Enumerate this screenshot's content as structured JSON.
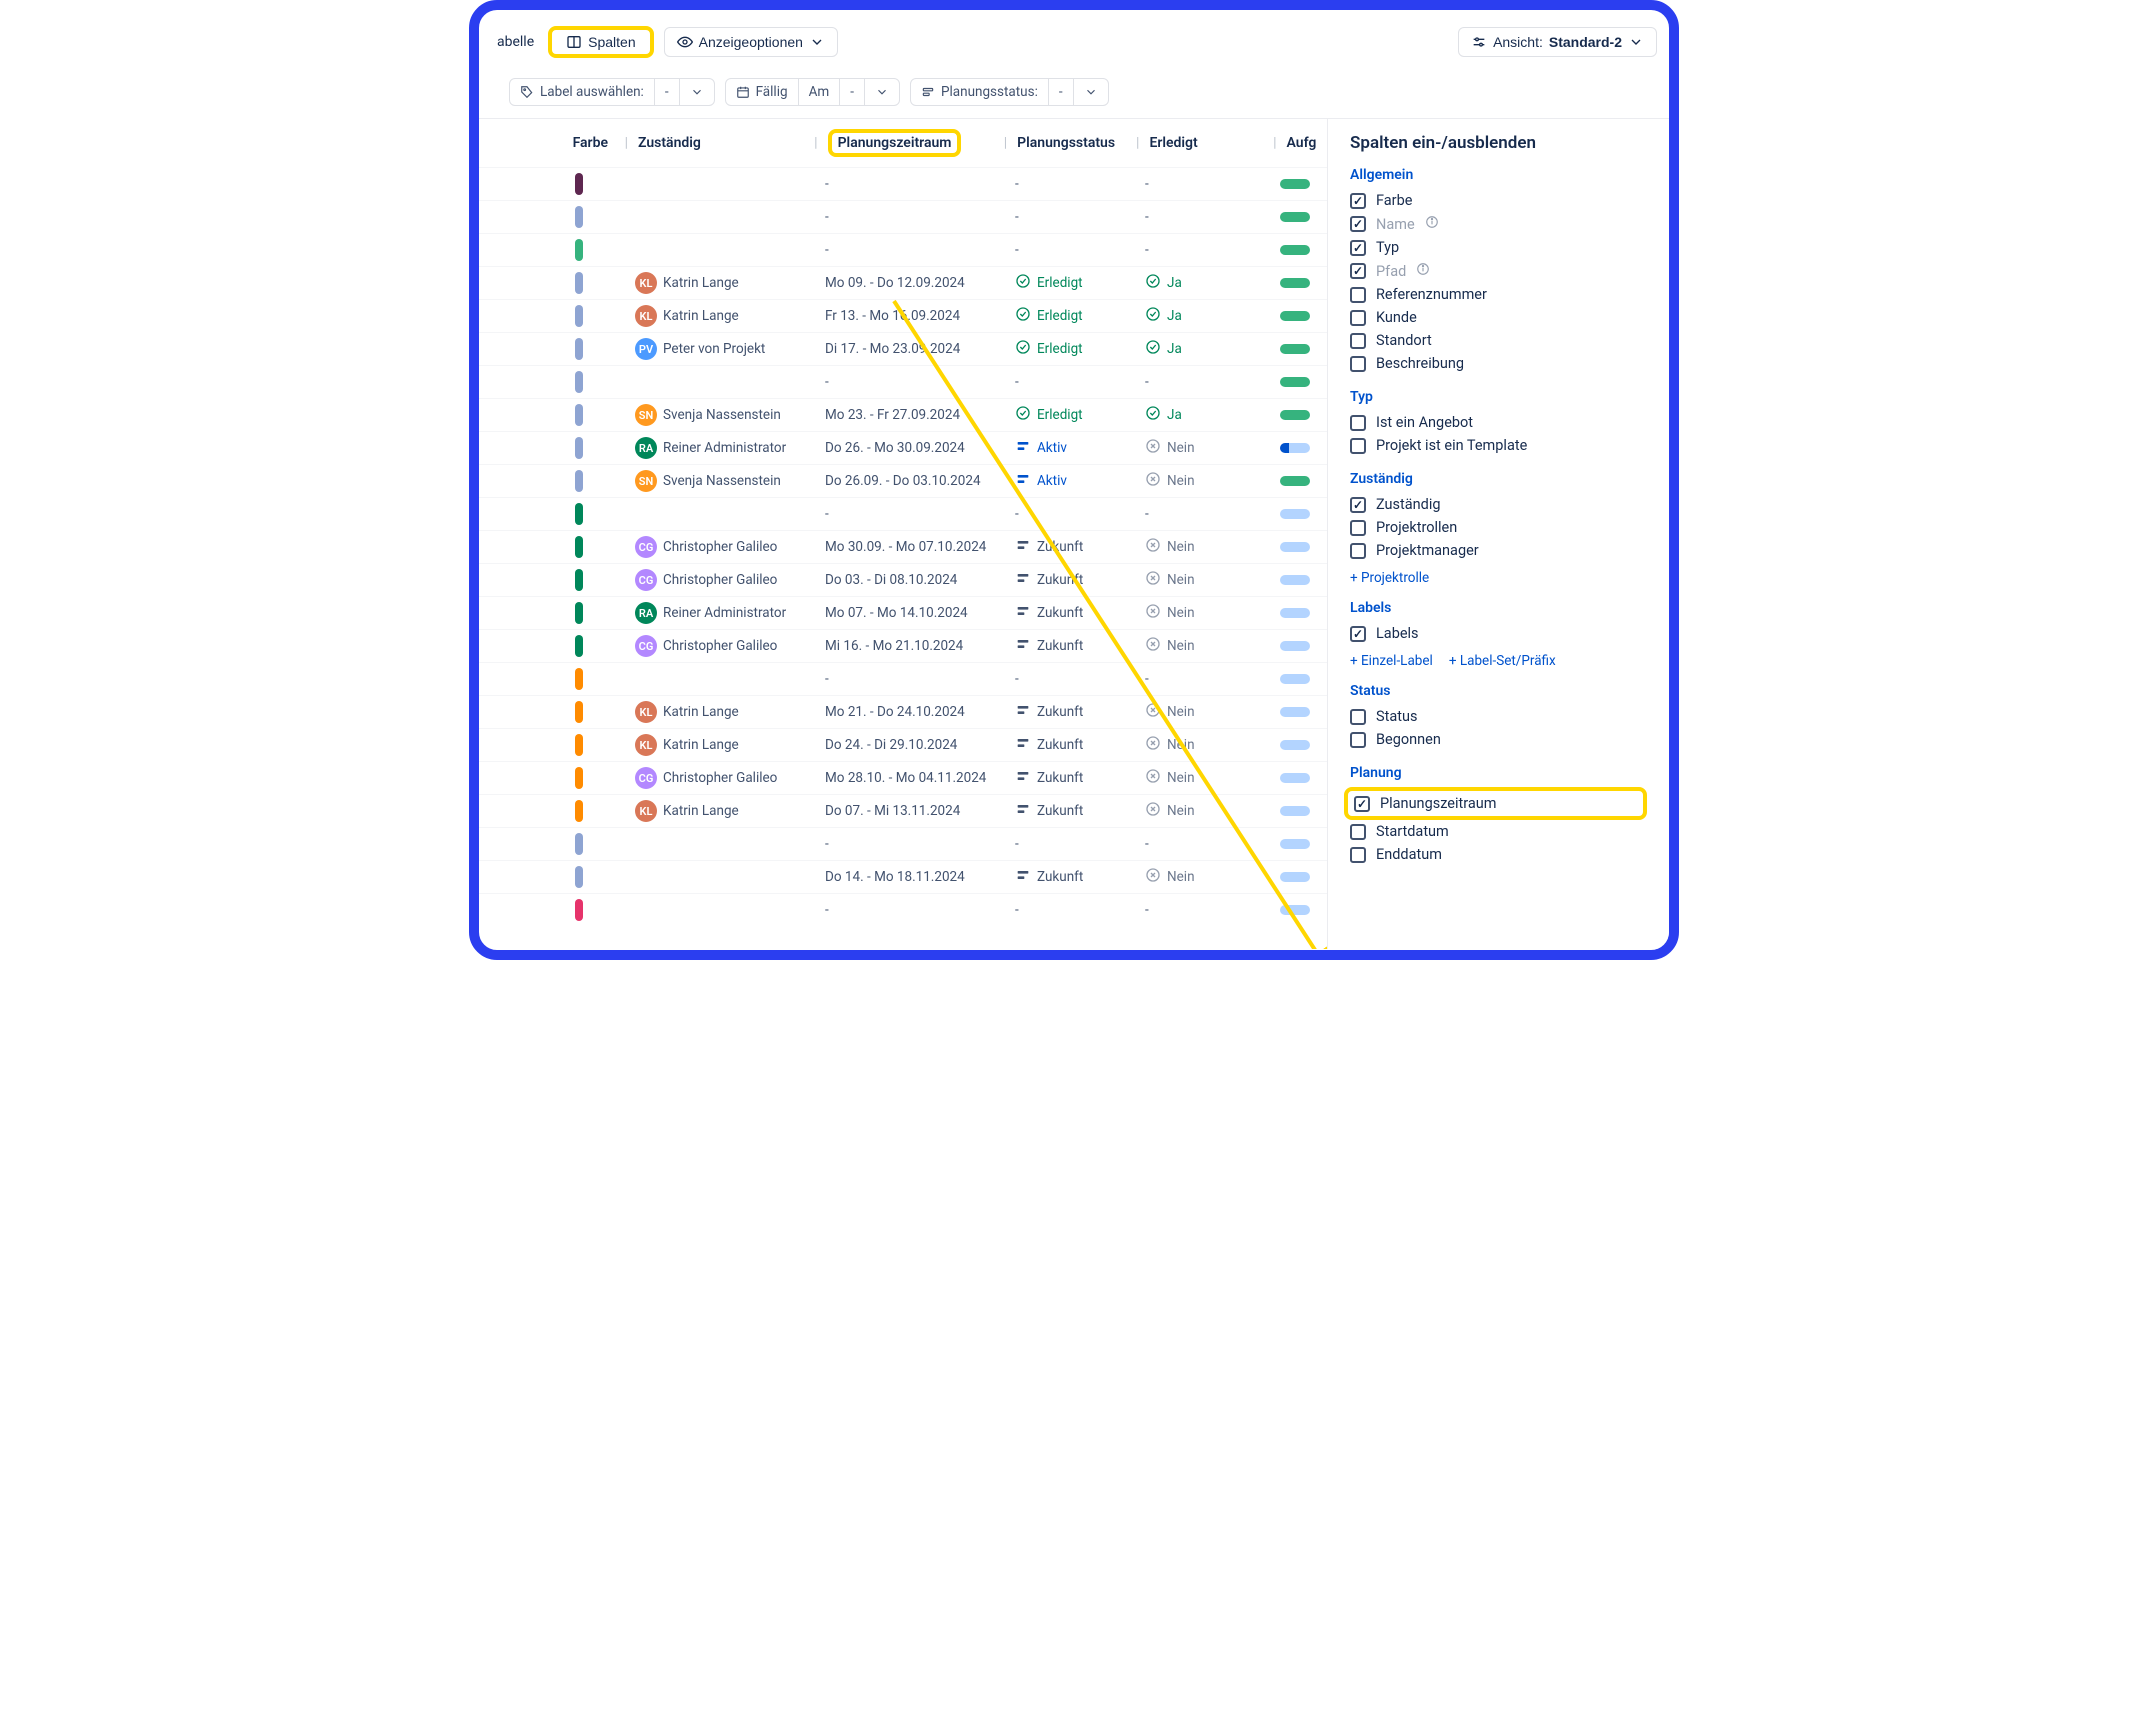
{
  "toolbar": {
    "tabelle_label": "abelle",
    "spalten_label": "Spalten",
    "anzeige_label": "Anzeigeoptionen",
    "ansicht_prefix": "Ansicht:",
    "ansicht_value": "Standard-2"
  },
  "filters": {
    "label_select": "Label auswählen:",
    "label_dash": "-",
    "faellig": "Fällig",
    "am": "Am",
    "am_dash": "-",
    "planungsstatus": "Planungsstatus:",
    "plan_dash": "-"
  },
  "columns": {
    "farbe": "Farbe",
    "zustaendig": "Zuständig",
    "planungszeitraum": "Planungszeitraum",
    "planungsstatus": "Planungsstatus",
    "erledigt": "Erledigt",
    "aufg": "Aufg"
  },
  "rows": [
    {
      "color": "#5e2750",
      "assignee": null,
      "range": "-",
      "status": "-",
      "done": "-",
      "bar": "green"
    },
    {
      "color": "#8ea4d2",
      "assignee": null,
      "range": "-",
      "status": "-",
      "done": "-",
      "bar": "green"
    },
    {
      "color": "#36b37e",
      "assignee": null,
      "range": "-",
      "status": "-",
      "done": "-",
      "bar": "green"
    },
    {
      "color": "#8ea4d2",
      "assignee": {
        "name": "Katrin Lange",
        "bg": "#d97757"
      },
      "range": "Mo 09. - Do 12.09.2024",
      "status": "Erledigt",
      "done": "Ja",
      "bar": "green"
    },
    {
      "color": "#8ea4d2",
      "assignee": {
        "name": "Katrin Lange",
        "bg": "#d97757"
      },
      "range": "Fr 13. - Mo 16.09.2024",
      "status": "Erledigt",
      "done": "Ja",
      "bar": "green"
    },
    {
      "color": "#8ea4d2",
      "assignee": {
        "name": "Peter von Projekt",
        "bg": "#4c9aff"
      },
      "range": "Di 17. - Mo 23.09.2024",
      "status": "Erledigt",
      "done": "Ja",
      "bar": "green"
    },
    {
      "color": "#8ea4d2",
      "assignee": null,
      "range": "-",
      "status": "-",
      "done": "-",
      "bar": "green"
    },
    {
      "color": "#8ea4d2",
      "assignee": {
        "name": "Svenja Nassenstein",
        "bg": "#ff991f"
      },
      "range": "Mo 23. - Fr 27.09.2024",
      "status": "Erledigt",
      "done": "Ja",
      "bar": "green"
    },
    {
      "color": "#8ea4d2",
      "assignee": {
        "name": "Reiner Administrator",
        "bg": "#00875a"
      },
      "range": "Do 26. - Mo 30.09.2024",
      "status": "Aktiv",
      "done": "Nein",
      "bar": "halfblue"
    },
    {
      "color": "#8ea4d2",
      "assignee": {
        "name": "Svenja Nassenstein",
        "bg": "#ff991f"
      },
      "range": "Do 26.09. - Do 03.10.2024",
      "status": "Aktiv",
      "done": "Nein",
      "bar": "green"
    },
    {
      "color": "#00875a",
      "assignee": null,
      "range": "-",
      "status": "-",
      "done": "-",
      "bar": "grayblue"
    },
    {
      "color": "#00875a",
      "assignee": {
        "name": "Christopher Galileo",
        "bg": "#b388ff"
      },
      "range": "Mo 30.09. - Mo 07.10.2024",
      "status": "Zukunft",
      "done": "Nein",
      "bar": "grayblue"
    },
    {
      "color": "#00875a",
      "assignee": {
        "name": "Christopher Galileo",
        "bg": "#b388ff"
      },
      "range": "Do 03. - Di 08.10.2024",
      "status": "Zukunft",
      "done": "Nein",
      "bar": "grayblue"
    },
    {
      "color": "#00875a",
      "assignee": {
        "name": "Reiner Administrator",
        "bg": "#00875a"
      },
      "range": "Mo 07. - Mo 14.10.2024",
      "status": "Zukunft",
      "done": "Nein",
      "bar": "grayblue"
    },
    {
      "color": "#00875a",
      "assignee": {
        "name": "Christopher Galileo",
        "bg": "#b388ff"
      },
      "range": "Mi 16. - Mo 21.10.2024",
      "status": "Zukunft",
      "done": "Nein",
      "bar": "grayblue"
    },
    {
      "color": "#ff8b00",
      "assignee": null,
      "range": "-",
      "status": "-",
      "done": "-",
      "bar": "grayblue"
    },
    {
      "color": "#ff8b00",
      "assignee": {
        "name": "Katrin Lange",
        "bg": "#d97757"
      },
      "range": "Mo 21. - Do 24.10.2024",
      "status": "Zukunft",
      "done": "Nein",
      "bar": "grayblue"
    },
    {
      "color": "#ff8b00",
      "assignee": {
        "name": "Katrin Lange",
        "bg": "#d97757"
      },
      "range": "Do 24. - Di 29.10.2024",
      "status": "Zukunft",
      "done": "Nein",
      "bar": "grayblue"
    },
    {
      "color": "#ff8b00",
      "assignee": {
        "name": "Christopher Galileo",
        "bg": "#b388ff"
      },
      "range": "Mo 28.10. - Mo 04.11.2024",
      "status": "Zukunft",
      "done": "Nein",
      "bar": "grayblue"
    },
    {
      "color": "#ff8b00",
      "assignee": {
        "name": "Katrin Lange",
        "bg": "#d97757"
      },
      "range": "Do 07. - Mi 13.11.2024",
      "status": "Zukunft",
      "done": "Nein",
      "bar": "grayblue"
    },
    {
      "color": "#8ea4d2",
      "assignee": null,
      "range": "-",
      "status": "-",
      "done": "-",
      "bar": "grayblue"
    },
    {
      "color": "#8ea4d2",
      "assignee": null,
      "range": "Do 14. - Mo 18.11.2024",
      "status": "Zukunft",
      "done": "Nein",
      "bar": "grayblue"
    },
    {
      "color": "#e6336b",
      "assignee": null,
      "range": "-",
      "status": "-",
      "done": "-",
      "bar": "grayblue"
    }
  ],
  "panel": {
    "title": "Spalten ein-/ausblenden",
    "groups": [
      {
        "title": "Allgemein",
        "items": [
          {
            "label": "Farbe",
            "checked": true
          },
          {
            "label": "Name",
            "checked": true,
            "muted": true,
            "info": true
          },
          {
            "label": "Typ",
            "checked": true
          },
          {
            "label": "Pfad",
            "checked": true,
            "muted": true,
            "info": true
          },
          {
            "label": "Referenznummer",
            "checked": false
          },
          {
            "label": "Kunde",
            "checked": false
          },
          {
            "label": "Standort",
            "checked": false
          },
          {
            "label": "Beschreibung",
            "checked": false
          }
        ]
      },
      {
        "title": "Typ",
        "items": [
          {
            "label": "Ist ein Angebot",
            "checked": false
          },
          {
            "label": "Projekt ist ein Template",
            "checked": false
          }
        ]
      },
      {
        "title": "Zuständig",
        "items": [
          {
            "label": "Zuständig",
            "checked": true
          },
          {
            "label": "Projektrollen",
            "checked": false
          },
          {
            "label": "Projektmanager",
            "checked": false
          }
        ],
        "links": [
          "+ Projektrolle"
        ]
      },
      {
        "title": "Labels",
        "items": [
          {
            "label": "Labels",
            "checked": true
          }
        ],
        "links": [
          "+ Einzel-Label",
          "+ Label-Set/Präfix"
        ]
      },
      {
        "title": "Status",
        "items": [
          {
            "label": "Status",
            "checked": false
          },
          {
            "label": "Begonnen",
            "checked": false
          }
        ]
      },
      {
        "title": "Planung",
        "items": [
          {
            "label": "Planungszeitraum",
            "checked": true,
            "highlight": true
          },
          {
            "label": "Startdatum",
            "checked": false
          },
          {
            "label": "Enddatum",
            "checked": false
          }
        ]
      }
    ]
  },
  "status_labels": {
    "Erledigt": "Erledigt",
    "Aktiv": "Aktiv",
    "Zukunft": "Zukunft"
  }
}
